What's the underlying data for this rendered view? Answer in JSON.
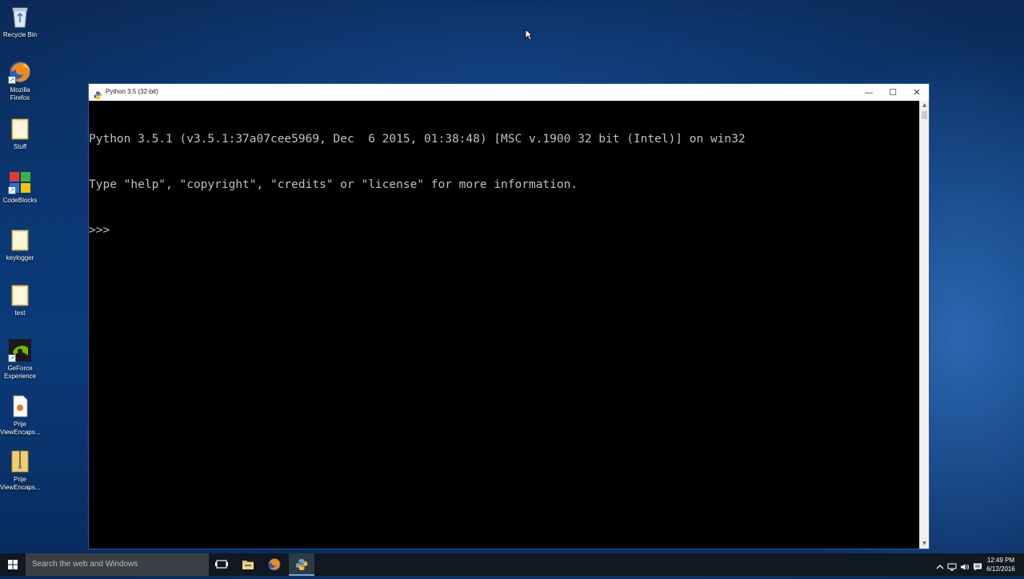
{
  "desktop": {
    "icons": [
      {
        "label": "Recycle Bin",
        "icon": "recycle-bin-icon"
      },
      {
        "label": "Mozilla Firefox",
        "icon": "firefox-icon"
      },
      {
        "label": "Stuff",
        "icon": "folder-icon"
      },
      {
        "label": "CodeBlocks",
        "icon": "codeblocks-icon"
      },
      {
        "label": "keylogger",
        "icon": "folder-icon"
      },
      {
        "label": "test",
        "icon": "folder-icon"
      },
      {
        "label": "GeForce Experience",
        "icon": "geforce-icon"
      },
      {
        "label": "Prije ViewEncaps...",
        "icon": "document-icon"
      },
      {
        "label": "Prije ViewEncaps...",
        "icon": "zip-folder-icon"
      }
    ]
  },
  "window": {
    "title": "Python 3.5 (32-bit)",
    "minimize_label": "—",
    "maximize_label": "☐",
    "close_label": "✕",
    "console_lines": [
      "Python 3.5.1 (v3.5.1:37a07cee5969, Dec  6 2015, 01:38:48) [MSC v.1900 32 bit (Intel)] on win32",
      "Type \"help\", \"copyright\", \"credits\" or \"license\" for more information.",
      ">>> "
    ]
  },
  "taskbar": {
    "search_placeholder": "Search the web and Windows",
    "clock_time": "12:49 PM",
    "clock_date": "6/12/2016"
  },
  "colors": {
    "console_text": "#c0c0c0",
    "console_bg": "#000000",
    "taskbar_bg": "#101820"
  }
}
